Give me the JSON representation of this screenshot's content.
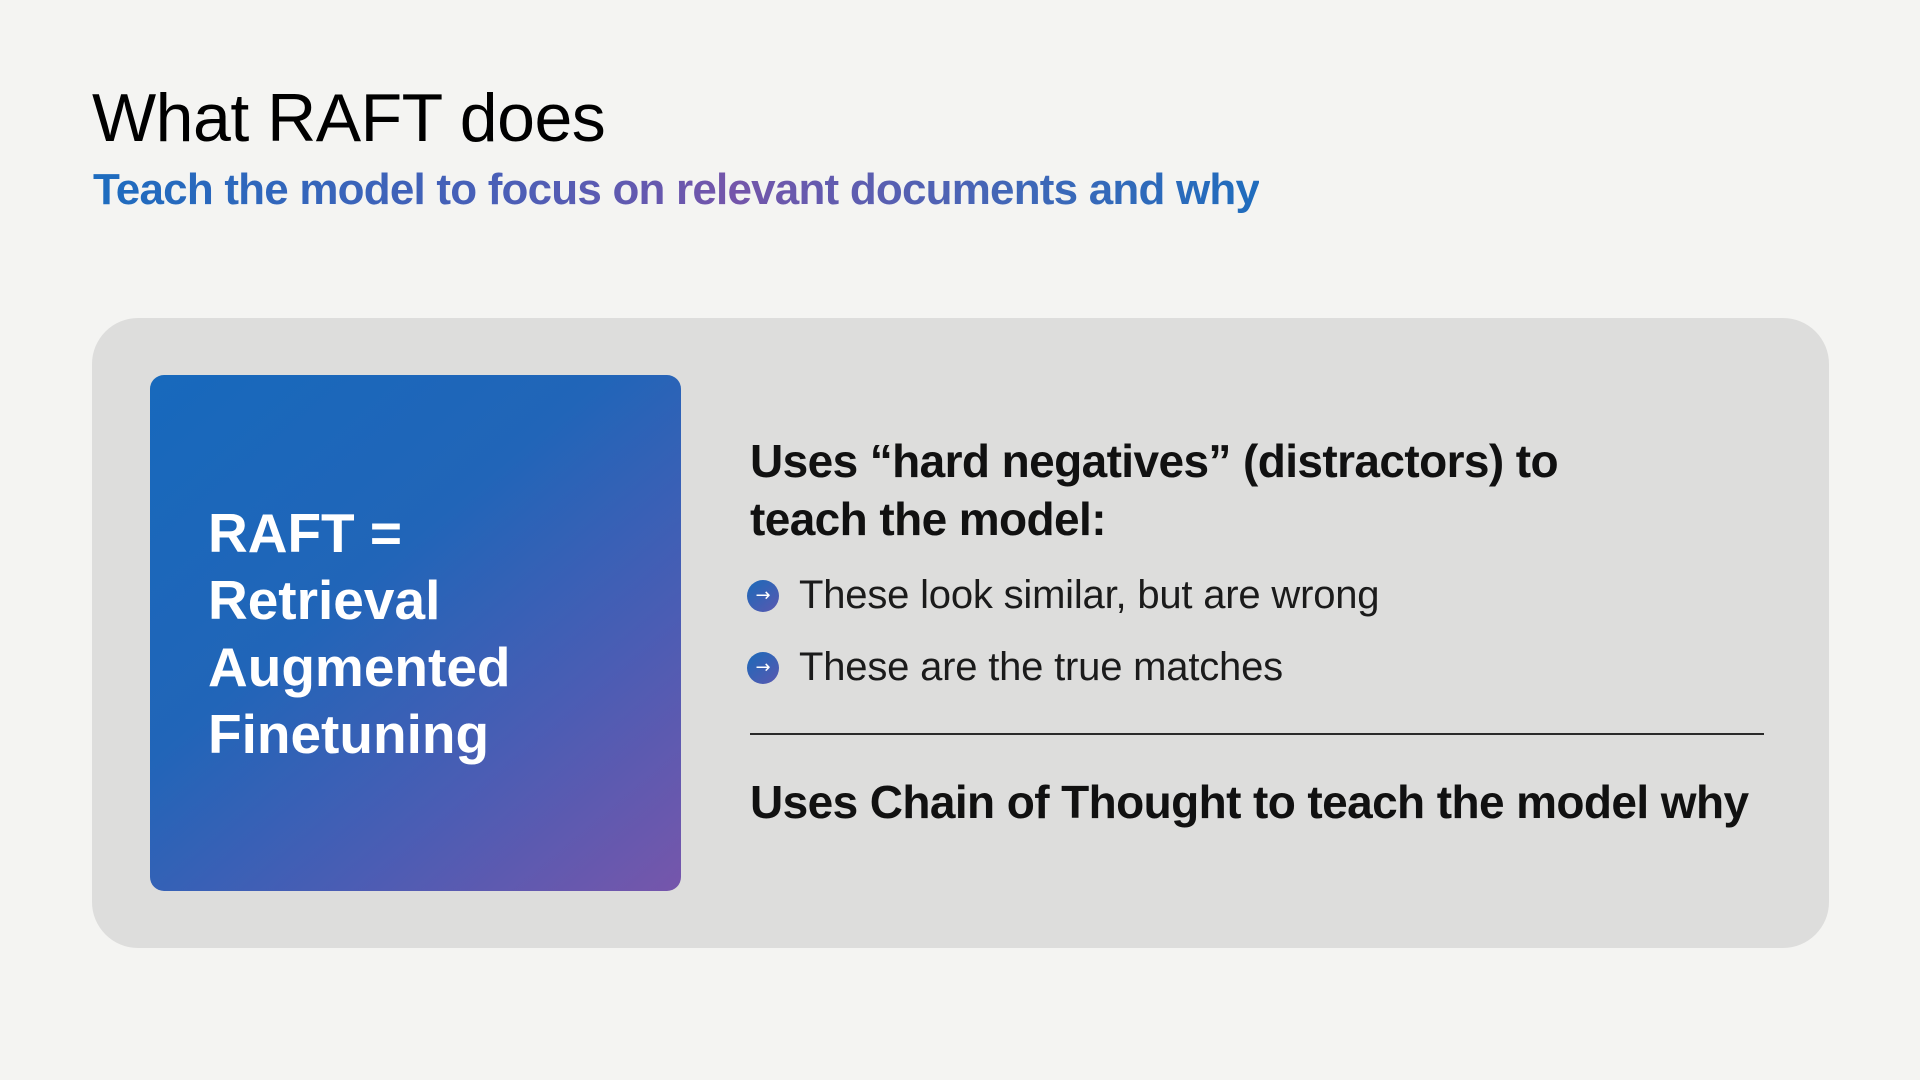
{
  "slide": {
    "title": "What RAFT does",
    "subtitle": "Teach the model to focus on relevant documents and why"
  },
  "raft_card": {
    "lines": [
      "RAFT =",
      "Retrieval",
      "Augmented",
      "Finetuning"
    ]
  },
  "content": {
    "heading_line1": "Uses “hard negatives” (distractors) to",
    "heading_line2": "teach the model:",
    "bullets": [
      {
        "icon": "arrow-right-icon",
        "glyph": "→",
        "text": "These look similar, but are wrong"
      },
      {
        "icon": "arrow-right-icon",
        "glyph": "→",
        "text": "These are the true matches"
      }
    ],
    "heading2": "Uses Chain of Thought to teach the model why"
  },
  "colors": {
    "title": "#000000",
    "subtitle_gradient": [
      "#1d6cbf",
      "#7455aa",
      "#1f6cbd"
    ],
    "panel_bg": "#dddddc",
    "card_gradient": [
      "#1769bc",
      "#7656ab"
    ],
    "background": "#f4f4f2"
  }
}
